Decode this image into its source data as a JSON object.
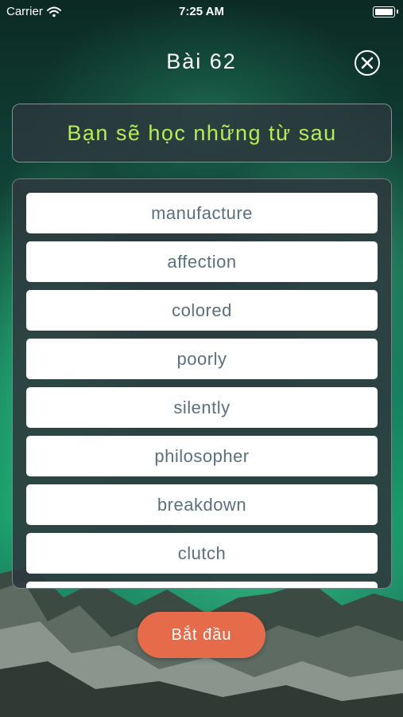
{
  "status_bar": {
    "carrier": "Carrier",
    "time": "7:25 AM"
  },
  "header": {
    "title": "Bài 62"
  },
  "banner": {
    "text": "Bạn sẽ học những từ sau"
  },
  "words": [
    "manufacture",
    "affection",
    "colored",
    "poorly",
    "silently",
    "philosopher",
    "breakdown",
    "clutch",
    ""
  ],
  "actions": {
    "start_label": "Bắt đầu"
  },
  "colors": {
    "banner_text": "#b6ec58",
    "start_button": "#e56b4a",
    "word_text": "#5b6f80"
  },
  "icons": {
    "close": "close-circle-icon",
    "wifi": "wifi-icon",
    "battery": "battery-icon"
  }
}
